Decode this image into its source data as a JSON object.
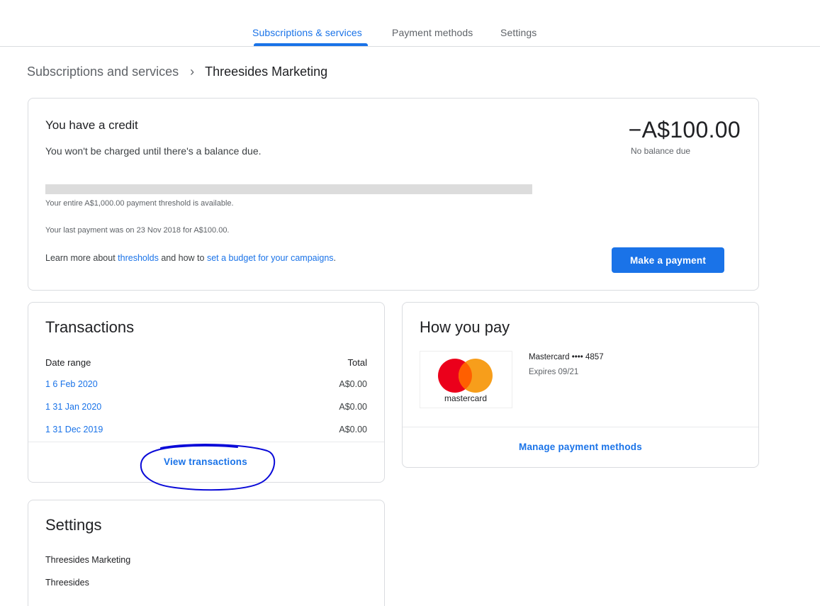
{
  "tabs": [
    {
      "label": "Subscriptions & services",
      "active": true
    },
    {
      "label": "Payment methods",
      "active": false
    },
    {
      "label": "Settings",
      "active": false
    }
  ],
  "breadcrumb": {
    "parent": "Subscriptions and services",
    "separator": "›",
    "current": "Threesides Marketing"
  },
  "credit": {
    "title": "You have a credit",
    "subtitle": "You won't be charged until there's a balance due.",
    "amount": "−A$100.00",
    "amount_caption": "No balance due",
    "threshold_progress_fraction": 0,
    "threshold_text": "Your entire A$1,000.00 payment threshold is available.",
    "last_payment_text": "Your last payment was on 23 Nov 2018 for A$100.00.",
    "learn_prefix": "Learn more about ",
    "learn_link1": "thresholds",
    "learn_mid": " and how to ",
    "learn_link2": "set a budget for your campaigns",
    "learn_suffix": ".",
    "pay_button": "Make a payment"
  },
  "transactions": {
    "title": "Transactions",
    "col_date": "Date range",
    "col_total": "Total",
    "rows": [
      {
        "date": "1  6 Feb 2020",
        "total": "A$0.00"
      },
      {
        "date": "1  31 Jan 2020",
        "total": "A$0.00"
      },
      {
        "date": "1  31 Dec 2019",
        "total": "A$0.00"
      }
    ],
    "view_link": "View transactions"
  },
  "how_you_pay": {
    "title": "How you pay",
    "card_logo_text": "mastercard",
    "card_name": "Mastercard •••• 4857",
    "card_expiry": "Expires 09/21",
    "manage_link": "Manage payment methods"
  },
  "settings": {
    "title": "Settings",
    "items": [
      "Threesides Marketing",
      "Threesides"
    ]
  },
  "colors": {
    "accent": "#1a73e8",
    "mastercard_red": "#eb001b",
    "mastercard_orange": "#f79e1b",
    "annotation_ink": "#0a0ad8"
  }
}
